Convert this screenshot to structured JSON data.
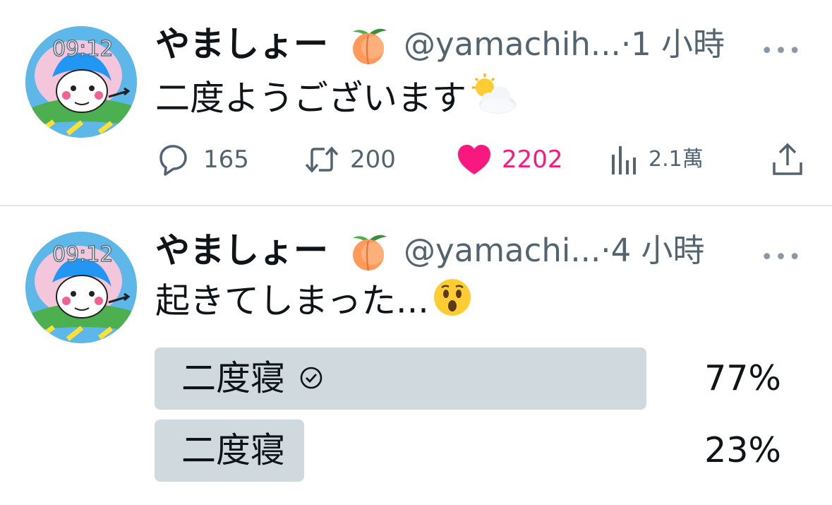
{
  "colors": {
    "text_primary": "#0f1419",
    "text_secondary": "#536471",
    "like_pink": "#f91880",
    "poll_bar": "#cfd9de",
    "divider": "#e3e6e8"
  },
  "tweets": [
    {
      "avatar": {
        "icon": "avatar-image",
        "clock_text": "09:12"
      },
      "author": {
        "name": "やましょー",
        "name_emoji": "peach-emoji",
        "handle_and_time": "@yamachih...·1 小時"
      },
      "more_icon": "more-horizontal-icon",
      "text": "二度ようございます",
      "text_emoji": "sun-behind-cloud-emoji",
      "actions": {
        "reply": {
          "icon": "reply-icon",
          "count": "165"
        },
        "retweet": {
          "icon": "retweet-icon",
          "count": "200"
        },
        "like": {
          "icon": "heart-icon",
          "count": "2202",
          "liked": true
        },
        "views": {
          "icon": "views-icon",
          "count": "2.1萬"
        },
        "share": {
          "icon": "share-icon"
        }
      }
    },
    {
      "avatar": {
        "icon": "avatar-image",
        "clock_text": "09:12"
      },
      "author": {
        "name": "やましょー",
        "name_emoji": "peach-emoji",
        "handle_and_time": "@yamachi...·4 小時"
      },
      "more_icon": "more-horizontal-icon",
      "text": "起きてしまった...",
      "text_emoji": "astonished-face-emoji",
      "poll": {
        "options": [
          {
            "label": "二度寝",
            "percent": "77%",
            "fraction": 0.77,
            "selected": true,
            "check_icon": "check-circle-icon"
          },
          {
            "label": "二度寝",
            "percent": "23%",
            "fraction": 0.23,
            "selected": false
          }
        ]
      }
    }
  ]
}
